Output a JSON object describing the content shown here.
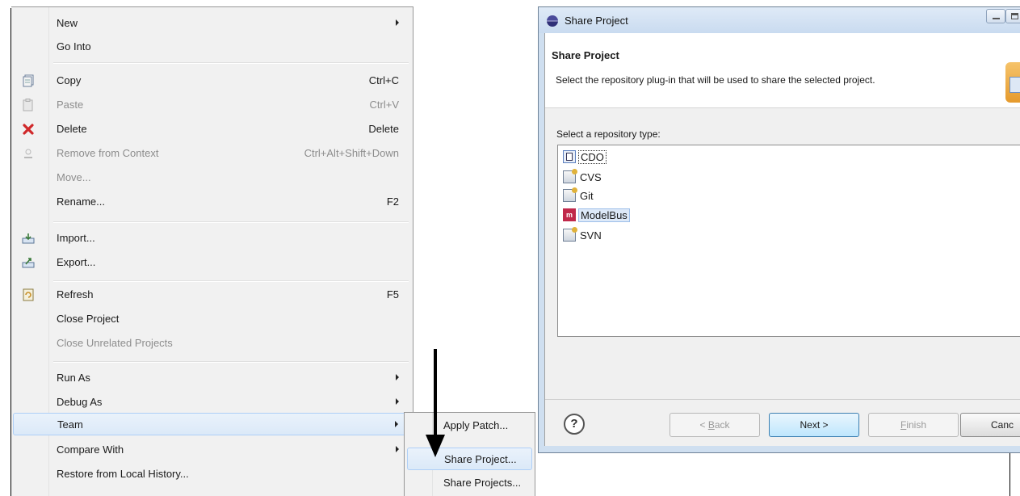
{
  "context_menu": {
    "items": [
      {
        "label": "New",
        "submenu": true
      },
      {
        "label": "Go Into"
      },
      {
        "label": "Copy",
        "shortcut": "Ctrl+C",
        "icon": "copy-icon"
      },
      {
        "label": "Paste",
        "shortcut": "Ctrl+V",
        "icon": "paste-icon",
        "disabled": true
      },
      {
        "label": "Delete",
        "shortcut": "Delete",
        "icon": "delete-icon"
      },
      {
        "label": "Remove from Context",
        "shortcut": "Ctrl+Alt+Shift+Down",
        "icon": "remove-context-icon",
        "disabled": true
      },
      {
        "label": "Move...",
        "disabled": true
      },
      {
        "label": "Rename...",
        "shortcut": "F2"
      },
      {
        "label": "Import...",
        "icon": "import-icon"
      },
      {
        "label": "Export...",
        "icon": "export-icon"
      },
      {
        "label": "Refresh",
        "shortcut": "F5",
        "icon": "refresh-icon"
      },
      {
        "label": "Close Project"
      },
      {
        "label": "Close Unrelated Projects",
        "disabled": true
      },
      {
        "label": "Run As",
        "submenu": true
      },
      {
        "label": "Debug As",
        "submenu": true
      },
      {
        "label": "Team",
        "submenu": true,
        "highlighted": true
      },
      {
        "label": "Compare With",
        "submenu": true
      },
      {
        "label": "Restore from Local History..."
      }
    ]
  },
  "team_submenu": {
    "items": [
      {
        "label": "Apply Patch..."
      },
      {
        "label": "Share Project...",
        "highlighted": true
      },
      {
        "label": "Share Projects..."
      }
    ]
  },
  "dialog": {
    "title": "Share Project",
    "heading": "Share Project",
    "description": "Select the repository plug-in that will be used to share the selected project.",
    "list_label": "Select a repository type:",
    "repositories": [
      {
        "label": "CDO",
        "icon": "cdo-icon",
        "focused": true
      },
      {
        "label": "CVS",
        "icon": "cvs-icon"
      },
      {
        "label": "Git",
        "icon": "git-icon"
      },
      {
        "label": "ModelBus",
        "icon": "modelbus-icon",
        "selected": true
      },
      {
        "label": "SVN",
        "icon": "svn-icon"
      }
    ],
    "modelbus_icon_text": "m",
    "help_symbol": "?",
    "buttons": {
      "back_prefix": "< ",
      "back_mnemonic": "B",
      "back_rest": "ack",
      "next": "Next >",
      "finish_mnemonic": "F",
      "finish_rest": "inish",
      "cancel": "Canc"
    }
  },
  "colors": {
    "menu_bg": "#f1f1f1",
    "highlight_border": "#aecff7",
    "dialog_frame": "#cfdff0",
    "default_button_border": "#3c7fb1",
    "modelbus_brand": "#c0284a"
  }
}
